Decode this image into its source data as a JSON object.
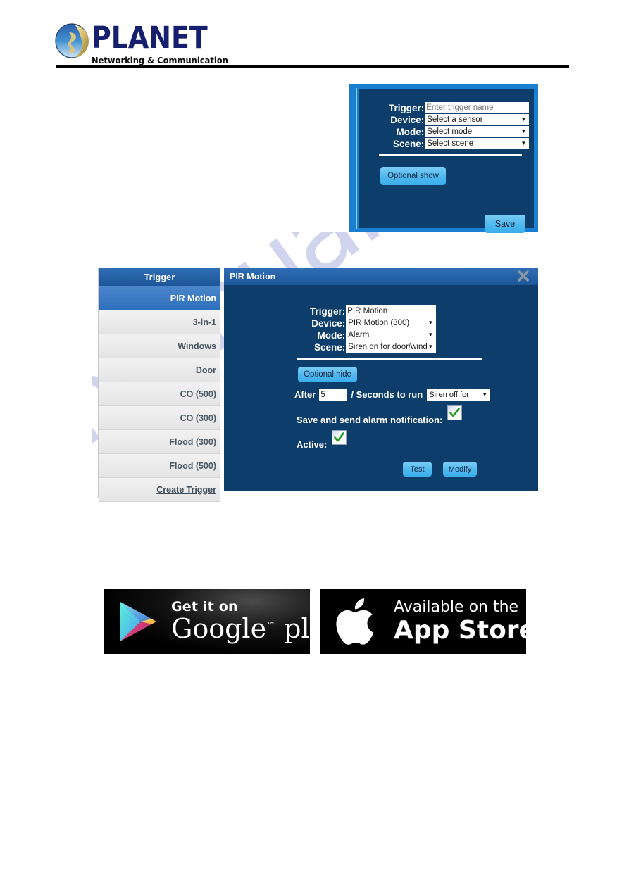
{
  "header": {
    "brand": "PLANET",
    "tagline": "Networking & Communication",
    "logo_icon": "planet-globe-icon"
  },
  "watermark": {
    "text": "manualsville.com"
  },
  "create_trigger_dialog": {
    "fields": [
      {
        "label": "Trigger:",
        "type": "text",
        "value": "",
        "placeholder": "Enter trigger name"
      },
      {
        "label": "Device:",
        "type": "select",
        "value": "Select a sensor"
      },
      {
        "label": "Mode:",
        "type": "select",
        "value": "Select mode"
      },
      {
        "label": "Scene:",
        "type": "select",
        "value": "Select scene"
      }
    ],
    "optional_button": "Optional show",
    "save_button": "Save"
  },
  "trigger_list": {
    "header": "Trigger",
    "items": [
      {
        "label": "PIR Motion",
        "selected": true
      },
      {
        "label": "3-in-1",
        "selected": false
      },
      {
        "label": "Windows",
        "selected": false
      },
      {
        "label": "Door",
        "selected": false
      },
      {
        "label": "CO (500)",
        "selected": false
      },
      {
        "label": "CO (300)",
        "selected": false
      },
      {
        "label": "Flood (300)",
        "selected": false
      },
      {
        "label": "Flood (500)",
        "selected": false
      }
    ],
    "create_link": "Create Trigger"
  },
  "pir_panel": {
    "title": "PIR Motion",
    "close_icon": "close-icon",
    "fields": [
      {
        "label": "Trigger:",
        "type": "text",
        "value": "PIR Motion"
      },
      {
        "label": "Device:",
        "type": "select",
        "value": "PIR Motion (300)"
      },
      {
        "label": "Mode:",
        "type": "select",
        "value": "Alarm"
      },
      {
        "label": "Scene:",
        "type": "select",
        "value": "Siren on for door/wind"
      }
    ],
    "optional_button": "Optional hide",
    "after_row": {
      "prefix": "After",
      "seconds_value": "5",
      "middle": "/ Seconds to run",
      "run_select": "Siren off for"
    },
    "notify_label": "Save and send alarm notification:",
    "notify_checked": true,
    "active_label": "Active:",
    "active_checked": true,
    "test_button": "Test",
    "modify_button": "Modify"
  },
  "badges": {
    "google": {
      "line1": "Get it on",
      "line2": "Google",
      "sup": "™",
      "line2b": "play",
      "icon": "google-play-icon"
    },
    "apple": {
      "line1": "Available on the",
      "line2": "App Store",
      "icon": "apple-logo-icon"
    }
  },
  "colors": {
    "dialog_border": "#1a7fd0",
    "dialog_bg": "#0d3d6b",
    "title_blue": "#1d5698",
    "selected_blue": "#2e70bd",
    "button_blue": "#4fb8ef",
    "check_green": "#1f9a1f",
    "brand_navy": "#151f6e"
  }
}
